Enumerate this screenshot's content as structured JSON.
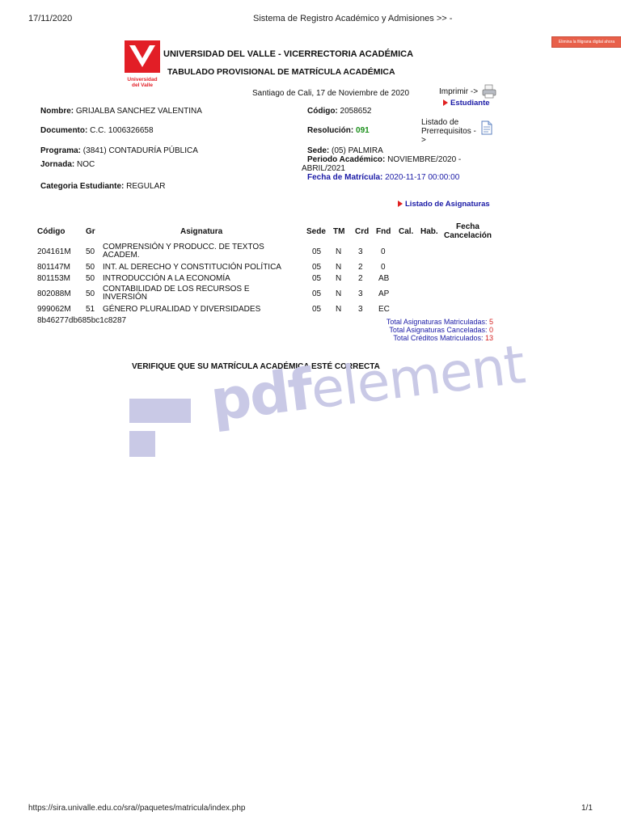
{
  "browser": {
    "date": "17/11/2020",
    "page_title": "Sistema de Registro Académico y Admisiones >> -",
    "url": "https://sira.univalle.edu.co/sra//paquetes/matricula/index.php",
    "page_number": "1/1"
  },
  "watermark_button": "Elimina la filigrana digital ahora",
  "logo": {
    "line1": "Universidad",
    "line2": "del Valle"
  },
  "header": {
    "title1": "UNIVERSIDAD DEL VALLE - VICERRECTORIA ACADÉMICA",
    "title2": "TABULADO PROVISIONAL DE MATRÍCULA ACADÉMICA",
    "place_date": "Santiago de Cali, 17 de Noviembre de 2020",
    "print_label": "Imprimir ->",
    "student_link": "Estudiante",
    "prereq_label": "Listado de Prerrequisitos ->"
  },
  "student": {
    "nombre_label": "Nombre:",
    "nombre": "GRIJALBA SANCHEZ VALENTINA",
    "codigo_label": "Código:",
    "codigo": "2058652",
    "documento_label": "Documento:",
    "documento": "C.C. 1006326658",
    "resolucion_label": "Resolución:",
    "resolucion": "091",
    "programa_label": "Programa:",
    "programa": "(3841) CONTADURÍA PÚBLICA",
    "sede_label": "Sede:",
    "sede": "(05) PALMIRA",
    "jornada_label": "Jornada:",
    "jornada": "NOC",
    "periodo_label": "Periodo Académico:",
    "periodo_1": "NOVIEMBRE/2020 -",
    "periodo_2": "ABRIL/2021",
    "fecha_label": "Fecha de Matrícula:",
    "fecha": "2020-11-17 00:00:00",
    "categoria_label": "Categoria Estudiante:",
    "categoria": "REGULAR"
  },
  "listado_link": "Listado de Asignaturas",
  "table": {
    "headers": {
      "codigo": "Código",
      "gr": "Gr",
      "asignatura": "Asignatura",
      "sede": "Sede",
      "tm": "TM",
      "crd": "Crd",
      "fnd": "Fnd",
      "cal": "Cal.",
      "hab": "Hab.",
      "fecha1": "Fecha",
      "fecha2": "Cancelación"
    },
    "rows": [
      {
        "codigo": "204161M",
        "gr": "50",
        "asig1": "COMPRENSIÓN Y PRODUCC. DE TEXTOS",
        "asig2": "ACADEM.",
        "sede": "05",
        "tm": "N",
        "crd": "3",
        "fnd": "0"
      },
      {
        "codigo": "801147M",
        "gr": "50",
        "asig1": "INT. AL DERECHO Y CONSTITUCIÓN POLÍTICA",
        "asig2": "",
        "sede": "05",
        "tm": "N",
        "crd": "2",
        "fnd": "0"
      },
      {
        "codigo": "801153M",
        "gr": "50",
        "asig1": "INTRODUCCIÓN A LA ECONOMÍA",
        "asig2": "",
        "sede": "05",
        "tm": "N",
        "crd": "2",
        "fnd": "AB"
      },
      {
        "codigo": "802088M",
        "gr": "50",
        "asig1": "CONTABILIDAD DE LOS RECURSOS E",
        "asig2": "INVERSIÓN",
        "sede": "05",
        "tm": "N",
        "crd": "3",
        "fnd": "AP"
      },
      {
        "codigo": "999062M",
        "gr": "51",
        "asig1": "GÉNERO PLURALIDAD Y DIVERSIDADES",
        "asig2": "",
        "sede": "05",
        "tm": "N",
        "crd": "3",
        "fnd": "EC"
      }
    ],
    "hash": "8b46277db685bc1c8287"
  },
  "totals": {
    "matriculadas_label": "Total Asignaturas Matriculadas:",
    "matriculadas": "5",
    "canceladas_label": "Total Asignaturas Canceladas:",
    "canceladas": "0",
    "creditos_label": "Total Créditos Matriculados:",
    "creditos": "13"
  },
  "verify_notice": "VERIFIQUE QUE SU MATRÍCULA ACADÉMICA ESTÉ CORRECTA",
  "pdf_watermark": {
    "bold": "pdf",
    "light": "element"
  }
}
